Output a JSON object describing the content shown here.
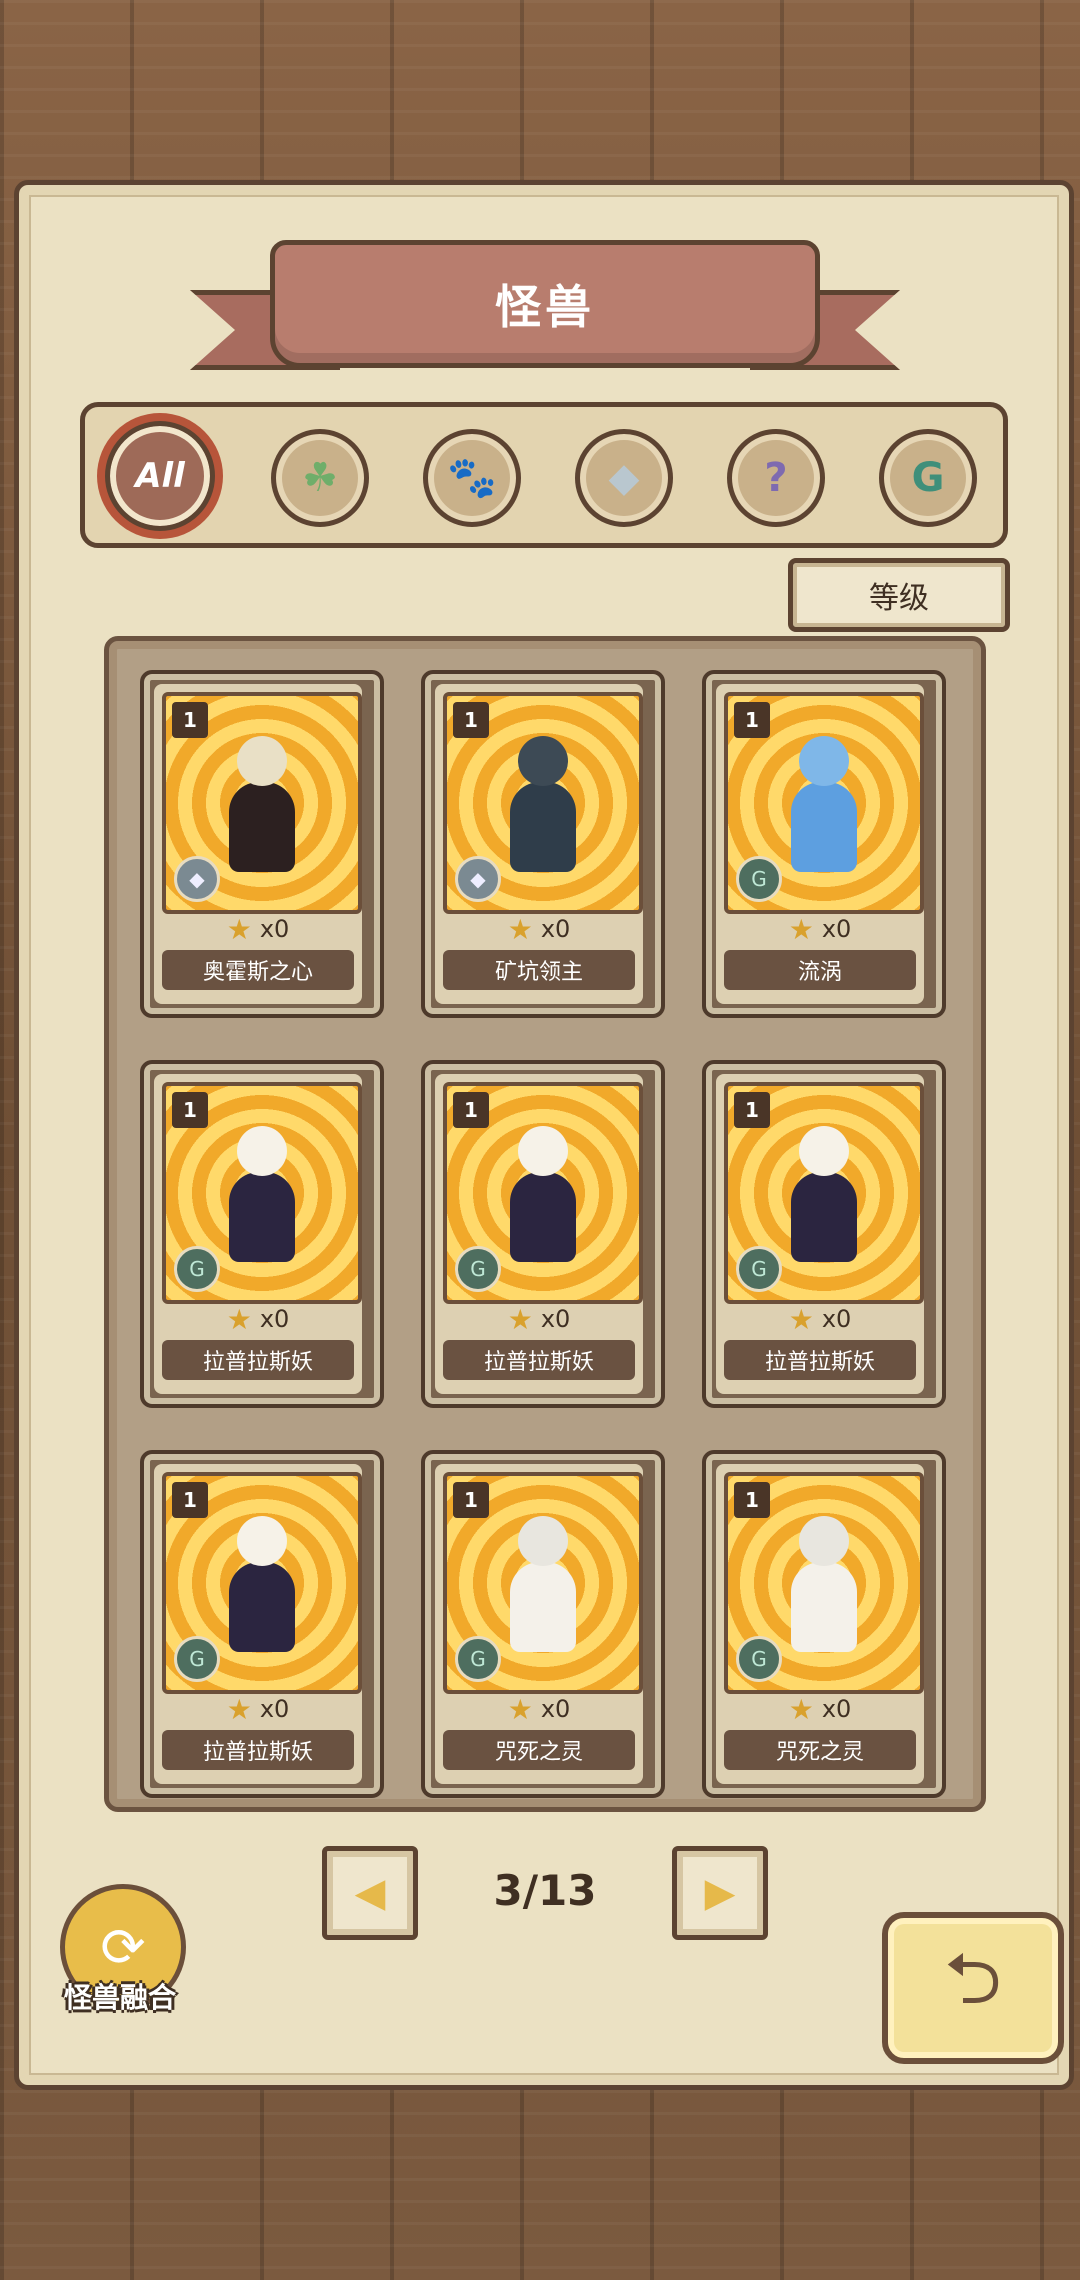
{
  "title": "怪兽",
  "filters": [
    {
      "label": "All",
      "icon": "all-icon",
      "active": true
    },
    {
      "label": "",
      "icon": "leaf-icon",
      "glyph": "☘",
      "color": "#6fae6a"
    },
    {
      "label": "",
      "icon": "paw-icon",
      "glyph": "🐾",
      "color": "#d68a2e"
    },
    {
      "label": "",
      "icon": "crystal-icon",
      "glyph": "◆",
      "color": "#b9c7cf"
    },
    {
      "label": "",
      "icon": "question-icon",
      "glyph": "?",
      "color": "#7e6ab0"
    },
    {
      "label": "",
      "icon": "rune-icon",
      "glyph": "G",
      "color": "#3f8f7a"
    }
  ],
  "sort_button": "等级",
  "cards": [
    {
      "level": "1",
      "name": "奥霍斯之心",
      "count": "x0",
      "type": "crystal-icon",
      "head": "#e9e0c6",
      "body": "#2c2020"
    },
    {
      "level": "1",
      "name": "矿坑领主",
      "count": "x0",
      "type": "crystal-icon",
      "head": "#3d4a55",
      "body": "#2f3d4a"
    },
    {
      "level": "1",
      "name": "流涡",
      "count": "x0",
      "type": "rune-icon",
      "head": "#7fb7e8",
      "body": "#5d9fe0"
    },
    {
      "level": "1",
      "name": "拉普拉斯妖",
      "count": "x0",
      "type": "rune-icon",
      "head": "#f6f2e8",
      "body": "#2b2540"
    },
    {
      "level": "1",
      "name": "拉普拉斯妖",
      "count": "x0",
      "type": "rune-icon",
      "head": "#f6f2e8",
      "body": "#2b2540"
    },
    {
      "level": "1",
      "name": "拉普拉斯妖",
      "count": "x0",
      "type": "rune-icon",
      "head": "#f6f2e8",
      "body": "#2b2540"
    },
    {
      "level": "1",
      "name": "拉普拉斯妖",
      "count": "x0",
      "type": "rune-icon",
      "head": "#f6f2e8",
      "body": "#2b2540"
    },
    {
      "level": "1",
      "name": "咒死之灵",
      "count": "x0",
      "type": "rune-icon",
      "head": "#e8e6df",
      "body": "#f4f1ea"
    },
    {
      "level": "1",
      "name": "咒死之灵",
      "count": "x0",
      "type": "rune-icon",
      "head": "#e8e6df",
      "body": "#f4f1ea"
    }
  ],
  "pagination": {
    "current": "3/13",
    "prev_icon": "triangle-left-icon",
    "next_icon": "triangle-right-icon"
  },
  "fusion_button": "怪兽融合",
  "back_icon": "back-arrow-icon"
}
